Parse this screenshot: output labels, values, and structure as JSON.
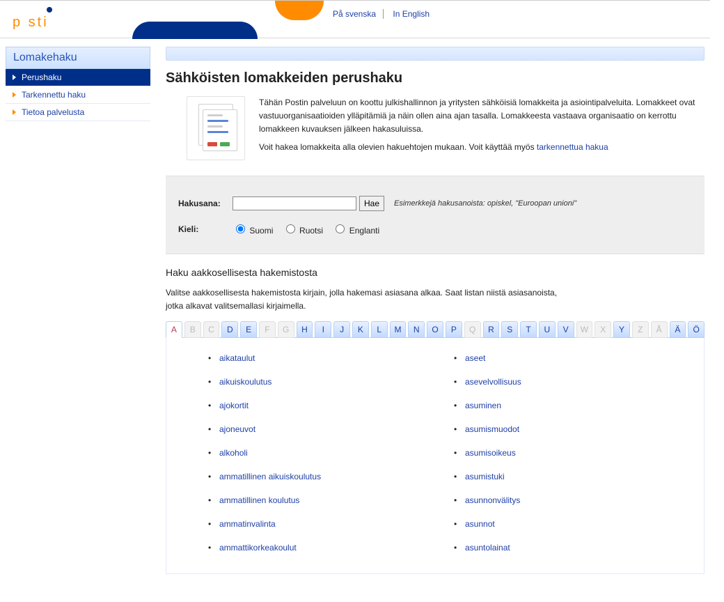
{
  "lang_links": {
    "sv": "På svenska",
    "en": "In English"
  },
  "logo_text": "p   sti",
  "sidebar": {
    "title": "Lomakehaku",
    "items": [
      {
        "label": "Perushaku",
        "active": true
      },
      {
        "label": "Tarkennettu haku",
        "active": false
      },
      {
        "label": "Tietoa palvelusta",
        "active": false
      }
    ]
  },
  "page_title": "Sähköisten lomakkeiden perushaku",
  "intro_p1": "Tähän Postin palveluun on koottu julkishallinnon ja yritysten sähköisiä lomakkeita ja asiointipalveluita. Lomakkeet ovat vastuuorganisaatioiden ylläpitämiä ja näin ollen aina ajan tasalla. Lomakkeesta vastaava organisaatio on kerrottu lomakkeen kuvauksen jälkeen hakasuluissa.",
  "intro_p2_a": "Voit hakea lomakkeita alla olevien hakuehtojen mukaan. Voit käyttää myös ",
  "intro_p2_link": "tarkennettua hakua",
  "search": {
    "hakusana_label": "Hakusana:",
    "hae_label": "Hae",
    "example": "Esimerkkejä hakusanoista: opiskel, \"Euroopan unioni\"",
    "kieli_label": "Kieli:",
    "radios": {
      "fi": "Suomi",
      "sv": "Ruotsi",
      "en": "Englanti"
    }
  },
  "alpha": {
    "title": "Haku aakkosellisesta hakemistosta",
    "desc": "Valitse aakkosellisesta hakemistosta kirjain, jolla hakemasi asiasana alkaa. Saat listan niistä asiasanoista, jotka alkavat valitsemallasi kirjaimella.",
    "letters": [
      {
        "l": "A",
        "state": "active"
      },
      {
        "l": "B",
        "state": "disabled"
      },
      {
        "l": "C",
        "state": "disabled"
      },
      {
        "l": "D",
        "state": "normal"
      },
      {
        "l": "E",
        "state": "normal"
      },
      {
        "l": "F",
        "state": "disabled"
      },
      {
        "l": "G",
        "state": "disabled"
      },
      {
        "l": "H",
        "state": "normal"
      },
      {
        "l": "I",
        "state": "normal"
      },
      {
        "l": "J",
        "state": "normal"
      },
      {
        "l": "K",
        "state": "normal"
      },
      {
        "l": "L",
        "state": "normal"
      },
      {
        "l": "M",
        "state": "normal"
      },
      {
        "l": "N",
        "state": "normal"
      },
      {
        "l": "O",
        "state": "normal"
      },
      {
        "l": "P",
        "state": "normal"
      },
      {
        "l": "Q",
        "state": "disabled"
      },
      {
        "l": "R",
        "state": "normal"
      },
      {
        "l": "S",
        "state": "normal"
      },
      {
        "l": "T",
        "state": "normal"
      },
      {
        "l": "U",
        "state": "normal"
      },
      {
        "l": "V",
        "state": "normal"
      },
      {
        "l": "W",
        "state": "disabled"
      },
      {
        "l": "X",
        "state": "disabled"
      },
      {
        "l": "Y",
        "state": "normal"
      },
      {
        "l": "Z",
        "state": "disabled"
      },
      {
        "l": "Å",
        "state": "disabled"
      },
      {
        "l": "Ä",
        "state": "normal"
      },
      {
        "l": "Ö",
        "state": "normal"
      }
    ]
  },
  "results_left": [
    "aikataulut",
    "aikuiskoulutus",
    "ajokortit",
    "ajoneuvot",
    "alkoholi",
    "ammatillinen aikuiskoulutus",
    "ammatillinen koulutus",
    "ammatinvalinta",
    "ammattikorkeakoulut"
  ],
  "results_right": [
    "aseet",
    "asevelvollisuus",
    "asuminen",
    "asumismuodot",
    "asumisoikeus",
    "asumistuki",
    "asunnonvälitys",
    "asunnot",
    "asuntolainat"
  ]
}
